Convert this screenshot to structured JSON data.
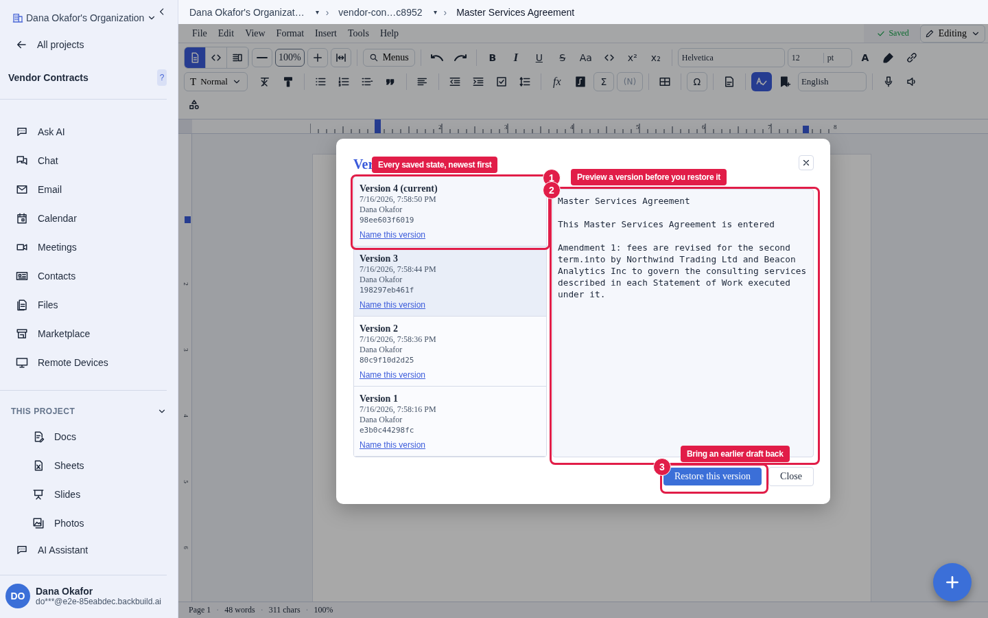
{
  "sidebar": {
    "org": "Dana Okafor's Organization",
    "back": "All projects",
    "project": "Vendor Contracts",
    "help": "?",
    "nav": [
      {
        "label": "Ask AI"
      },
      {
        "label": "Chat"
      },
      {
        "label": "Email"
      },
      {
        "label": "Calendar"
      },
      {
        "label": "Meetings"
      },
      {
        "label": "Contacts"
      },
      {
        "label": "Files"
      },
      {
        "label": "Marketplace"
      },
      {
        "label": "Remote Devices"
      }
    ],
    "section": "THIS PROJECT",
    "project_items": [
      {
        "label": "Docs"
      },
      {
        "label": "Sheets"
      },
      {
        "label": "Slides"
      },
      {
        "label": "Photos"
      }
    ],
    "assistant": "AI Assistant",
    "user": {
      "initials": "DO",
      "name": "Dana Okafor",
      "email": "do***@e2e-85eabdec.backbuild.ai"
    }
  },
  "breadcrumb": {
    "separator": "›",
    "dropdown_glyph": "▾",
    "items": [
      {
        "label": "Dana Okafor's Organizat…",
        "dropdown": true
      },
      {
        "label": "vendor-con…c8952",
        "dropdown": true
      },
      {
        "label": "Master Services Agreement",
        "dropdown": false
      }
    ]
  },
  "menubar": {
    "menus": [
      "File",
      "Edit",
      "View",
      "Format",
      "Insert",
      "Tools",
      "Help"
    ],
    "status": "Saved",
    "mode": "Editing"
  },
  "toolbar": {
    "view_modes": [
      {
        "selected": true
      },
      {
        "selected": false
      },
      {
        "selected": false
      }
    ],
    "zoom": "100%",
    "menus_search": "Menus",
    "format_buttons": [
      {
        "kind": "bold",
        "glyph": "B"
      },
      {
        "kind": "italic",
        "glyph": "I"
      },
      {
        "kind": "underline",
        "glyph": "U"
      },
      {
        "kind": "strike",
        "glyph": "S"
      },
      {
        "kind": "plain",
        "glyph": "Aa"
      }
    ],
    "script_buttons": [
      "x²",
      "x₂"
    ],
    "font": "Helvetica",
    "size": "12",
    "unit": "pt",
    "color_glyph": "A",
    "style": {
      "glyph": "T",
      "value": "Normal"
    },
    "fx": "fx",
    "sigma": "Σ",
    "footnote": "(N)",
    "omega": "Ω",
    "spellcheck_on": true,
    "language": "English"
  },
  "ruler": [
    "2",
    "3",
    "4",
    "5",
    "6",
    "7",
    "8"
  ],
  "vertical_ruler": [
    "2",
    "3",
    "4",
    "5",
    "6"
  ],
  "status_bar": {
    "separator": "·",
    "items": [
      "Page 1",
      "48 words",
      "311 chars",
      "100%"
    ]
  },
  "dialog": {
    "title": "Ver",
    "versions": [
      {
        "title": "Version 4 (current)",
        "time": "7/16/2026, 7:58:50 PM",
        "author": "Dana Okafor",
        "hash": "98ee603f6019",
        "link": "Name this version",
        "selected": false
      },
      {
        "title": "Version 3",
        "time": "7/16/2026, 7:58:44 PM",
        "author": "Dana Okafor",
        "hash": "198297eb461f",
        "link": "Name this version",
        "selected": true
      },
      {
        "title": "Version 2",
        "time": "7/16/2026, 7:58:36 PM",
        "author": "Dana Okafor",
        "hash": "80c9f10d2d25",
        "link": "Name this version",
        "selected": false
      },
      {
        "title": "Version 1",
        "time": "7/16/2026, 7:58:16 PM",
        "author": "Dana Okafor",
        "hash": "e3b0c44298fc",
        "link": "Name this version",
        "selected": false
      }
    ],
    "preview": [
      "Master Services Agreement",
      "This Master Services Agreement is entered",
      "Amendment 1: fees are revised for the second term.into by Northwind Trading Ltd and Beacon Analytics Inc to govern the consulting services described in each Statement of Work executed under it."
    ],
    "restore": "Restore this version",
    "close": "Close"
  },
  "tour": {
    "callouts": [
      "Every saved state, newest first",
      "Preview a version before you restore it",
      "Bring an earlier draft back"
    ],
    "badges": [
      "1",
      "2",
      "3"
    ]
  }
}
